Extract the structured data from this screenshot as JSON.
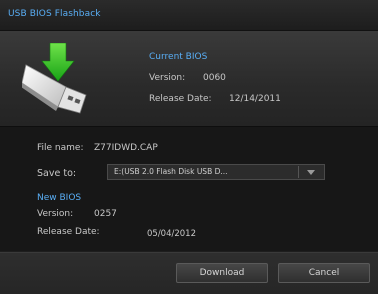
{
  "window": {
    "title": "USB BIOS Flashback"
  },
  "current_bios": {
    "heading": "Current BIOS",
    "version_label": "Version:",
    "version_value": "0060",
    "date_label": "Release Date:",
    "date_value": "12/14/2011"
  },
  "file": {
    "name_label": "File name:",
    "name_value": "Z77IDWD.CAP",
    "save_label": "Save to:",
    "save_value": "E:(USB 2.0 Flash Disk USB D..."
  },
  "new_bios": {
    "heading": "New BIOS",
    "version_label": "Version:",
    "version_value": "0257",
    "date_label": "Release Date:",
    "date_value": "05/04/2012"
  },
  "buttons": {
    "download": "Download",
    "cancel": "Cancel"
  },
  "icons": {
    "drive": "usb-drive-download-icon",
    "dropdown": "chevron-down-icon"
  },
  "colors": {
    "accent": "#59aef5",
    "arrow": "#22c41e"
  }
}
